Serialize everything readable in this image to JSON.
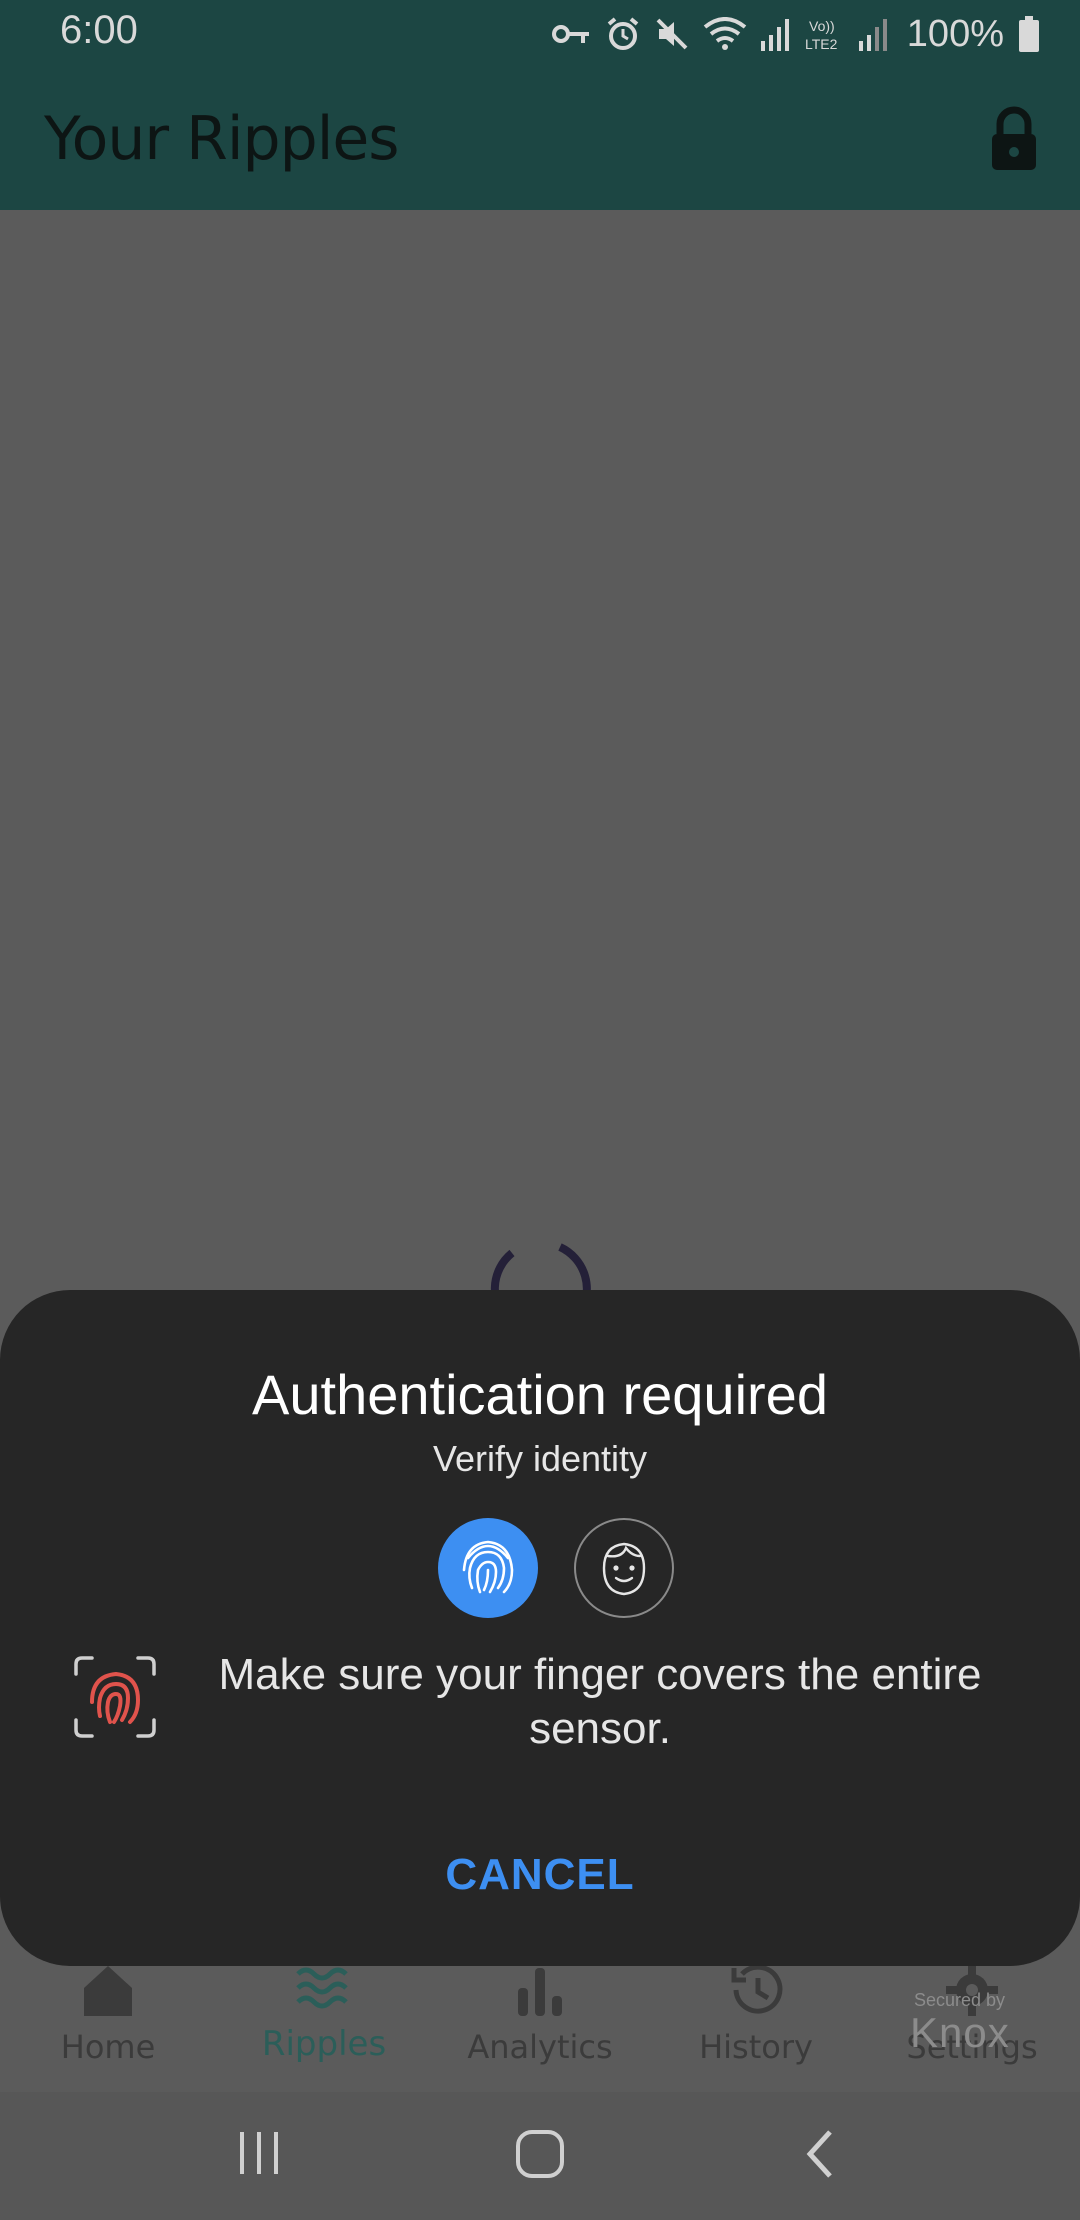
{
  "status_bar": {
    "time": "6:00",
    "battery": "100%",
    "icons": [
      "vpn-key-icon",
      "alarm-icon",
      "mute-icon",
      "wifi-icon",
      "signal-icon",
      "volte-lte2-icon",
      "signal-icon",
      "battery-icon"
    ]
  },
  "app_bar": {
    "title": "Your Ripples",
    "action_icon": "lock-icon"
  },
  "bottom_nav": {
    "items": [
      {
        "label": "Home",
        "icon": "home-icon"
      },
      {
        "label": "Ripples",
        "icon": "waves-icon",
        "active": true
      },
      {
        "label": "Analytics",
        "icon": "bar-chart-icon"
      },
      {
        "label": "History",
        "icon": "history-icon"
      },
      {
        "label": "Settings",
        "icon": "gear-icon"
      }
    ]
  },
  "knox": {
    "secured": "Secured by",
    "brand": "Knox"
  },
  "auth_sheet": {
    "title": "Authentication required",
    "subtitle": "Verify identity",
    "hint": "Make sure your finger covers the entire sensor.",
    "cancel_label": "CANCEL",
    "options": [
      "fingerprint-icon",
      "face-icon"
    ]
  },
  "colors": {
    "app_bar": "#1c4643",
    "scrim": "#5b5b5b",
    "sheet": "#262626",
    "accent": "#3d8ff2",
    "active_nav": "#2b5e59",
    "error_fingerprint": "#e0534c"
  }
}
